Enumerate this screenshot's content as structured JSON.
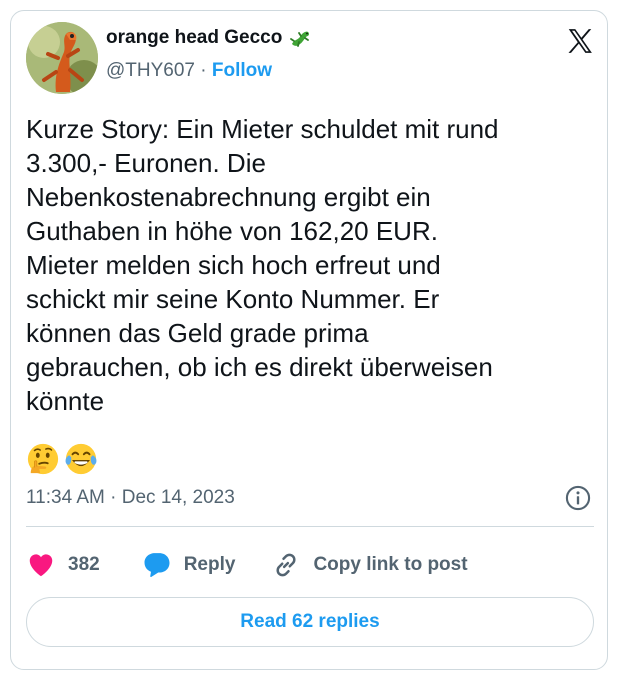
{
  "author": {
    "name": "orange head Gecco",
    "handle": "@THY607",
    "separator": "·",
    "follow_label": "Follow",
    "name_emoji_icon": "lizard-emoji"
  },
  "tweet": {
    "text": "Kurze Story: Ein Mieter schuldet mit rund\n3.300,- Euronen. Die\nNebenkostenabrechnung ergibt ein\nGuthaben in höhe von 162,20 EUR.\nMieter melden sich hoch erfreut und\nschickt mir seine Konto Nummer. Er\nkönnen das Geld grade prima\ngebrauchen, ob ich es direkt überweisen\nkönnte",
    "emojis": [
      "thinking-face-emoji",
      "face-with-tears-of-joy-emoji"
    ],
    "timestamp": "11:34 AM · Dec 14, 2023"
  },
  "actions": {
    "like_count": "382",
    "reply_label": "Reply",
    "copy_link_label": "Copy link to post"
  },
  "read_replies_label": "Read 62 replies",
  "colors": {
    "accent": "#1d9bf0",
    "like": "#f91880",
    "text": "#0f1419",
    "muted": "#536471",
    "border": "#cfd9de"
  }
}
